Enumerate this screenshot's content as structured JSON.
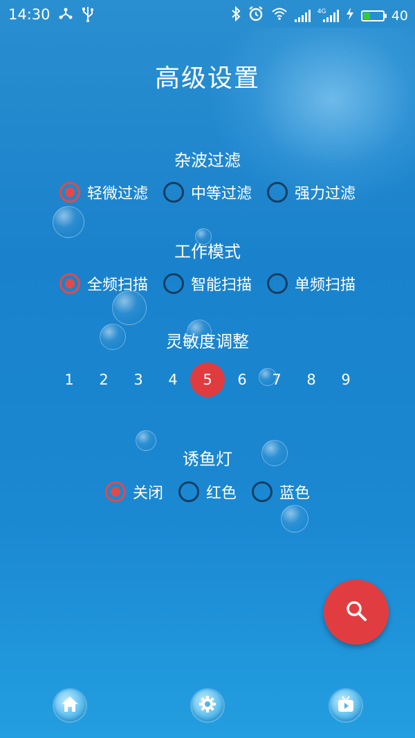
{
  "status_bar": {
    "time": "14:30",
    "network_type": "4G",
    "battery_level": "40",
    "battery_fraction": 0.4,
    "battery_color": "#33cc33",
    "icons": [
      "share-icon",
      "usb-icon",
      "bluetooth-icon",
      "alarm-icon",
      "wifi-icon",
      "signal-icon",
      "signal-4g-icon",
      "charging-icon",
      "battery-icon"
    ]
  },
  "page": {
    "title": "高级设置"
  },
  "clutter_filter": {
    "title": "杂波过滤",
    "options": [
      "轻微过滤",
      "中等过滤",
      "强力过滤"
    ],
    "selected": 0
  },
  "work_mode": {
    "title": "工作模式",
    "options": [
      "全频扫描",
      "智能扫描",
      "单频扫描"
    ],
    "selected": 0
  },
  "sensitivity": {
    "title": "灵敏度调整",
    "levels": [
      "1",
      "2",
      "3",
      "4",
      "5",
      "6",
      "7",
      "8",
      "9"
    ],
    "selected": 4
  },
  "fish_light": {
    "title": "诱鱼灯",
    "options": [
      "关闭",
      "红色",
      "蓝色"
    ],
    "selected": 0
  },
  "colors": {
    "accent": "#e24a4a",
    "radio_off": "#123e63",
    "background": "#1a82cc"
  },
  "fab": {
    "icon": "search-icon"
  },
  "bottom_nav": {
    "items": [
      "home-icon",
      "gear-icon",
      "tv-icon"
    ]
  }
}
